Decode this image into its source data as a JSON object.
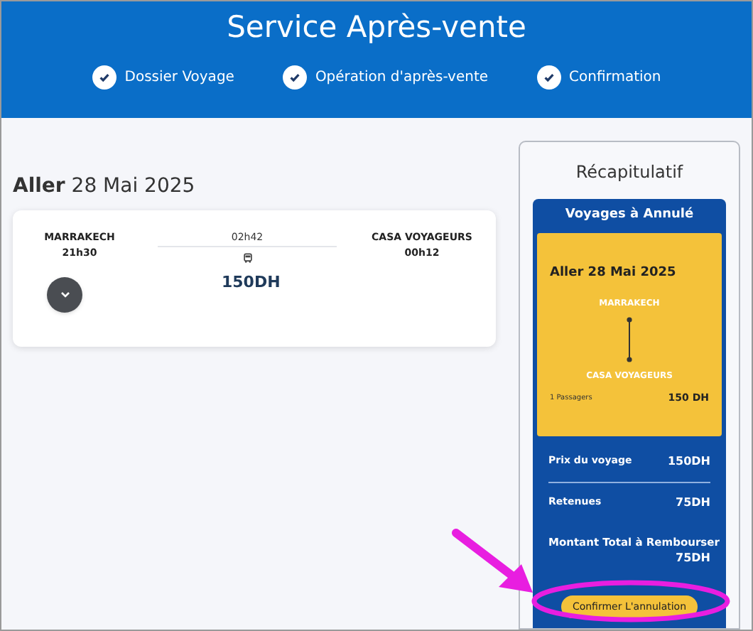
{
  "header": {
    "title": "Service Après-vente",
    "steps": [
      {
        "label": "Dossier Voyage",
        "checked": true
      },
      {
        "label": "Opération d'après-vente",
        "checked": true
      },
      {
        "label": "Confirmation",
        "checked": true
      }
    ]
  },
  "trip": {
    "heading": "**Aller** 28 Mai 2025",
    "from": {
      "city": "MARRAKECH",
      "time": "21h30"
    },
    "duration": "02h42",
    "to": {
      "city": "CASA VOYAGEURS",
      "time": "00h12"
    },
    "price": "150DH"
  },
  "summary": {
    "title": "Récapitulatif",
    "card_title": "Voyages à Annulé",
    "trip": {
      "heading": "Aller 28 Mai 2025",
      "from": "MARRAKECH",
      "to": "CASA VOYAGEURS",
      "passengers": "1 Passagers",
      "price": "150 DH"
    },
    "lines": [
      {
        "label": "Prix du voyage",
        "value": "150DH",
        "kind": "row"
      },
      {
        "label": "Retenues",
        "value": "75DH",
        "kind": "row"
      },
      {
        "label": "Montant Total à Rembourser",
        "value": "75DH",
        "kind": "total"
      }
    ],
    "button": "Confirmer L'annulation"
  }
}
